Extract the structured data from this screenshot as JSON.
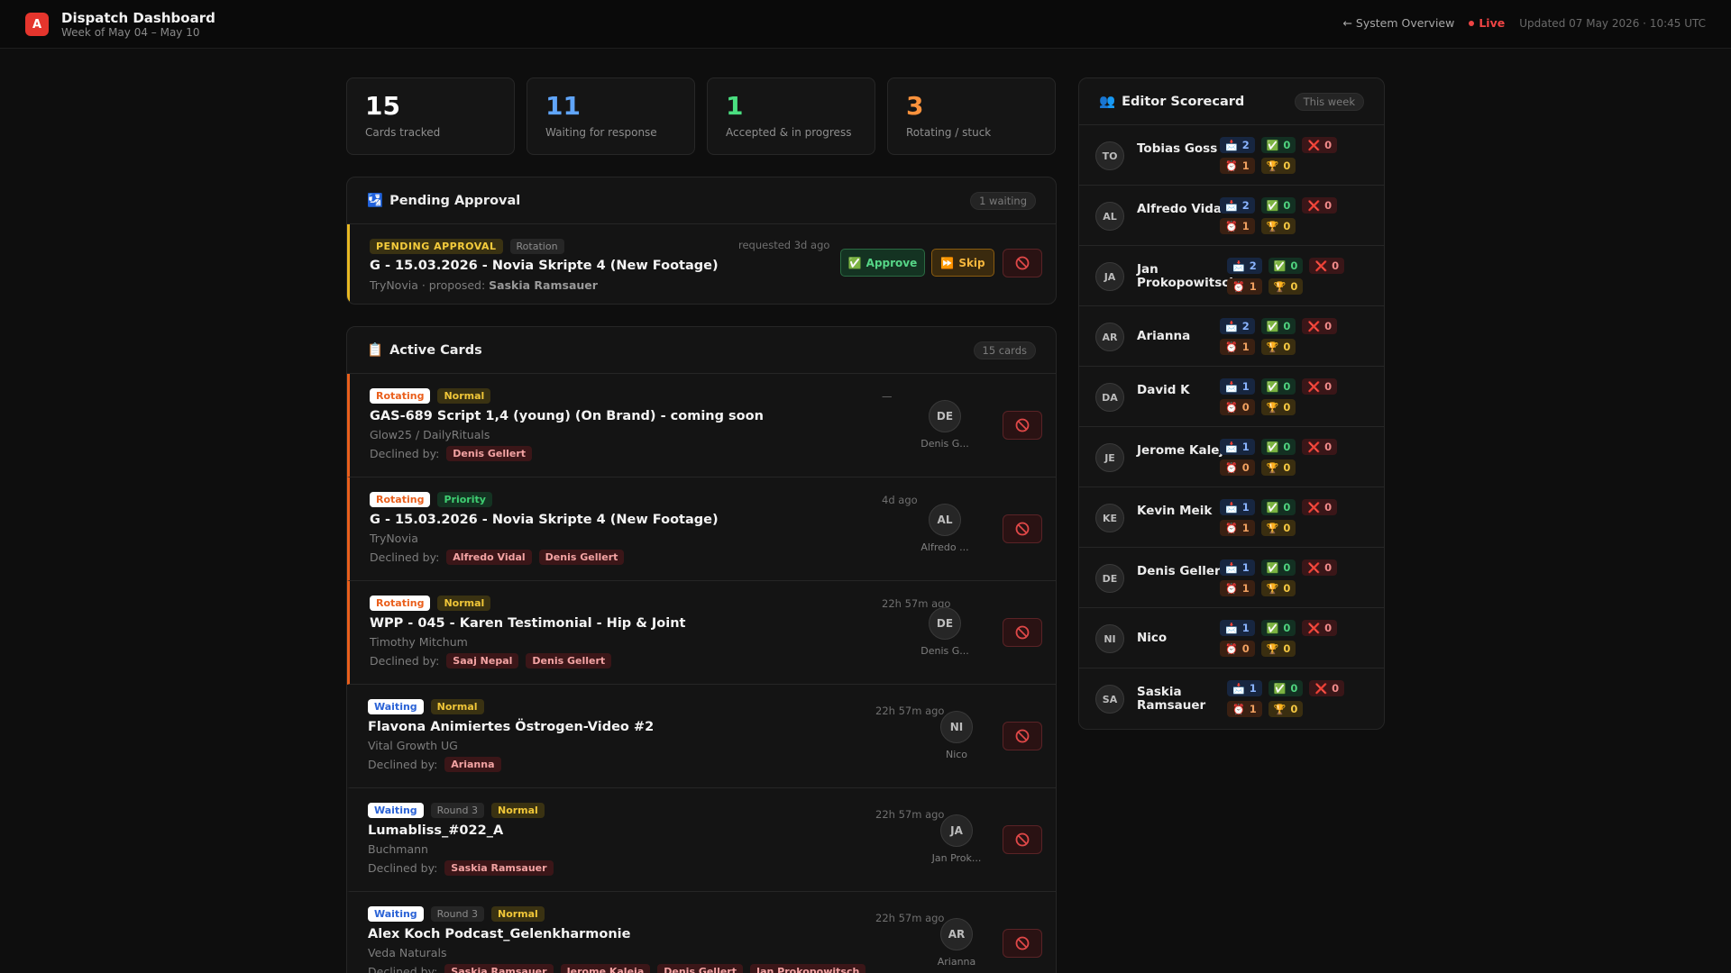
{
  "header": {
    "logo_letter": "A",
    "title": "Dispatch Dashboard",
    "subtitle": "Week of May 04 – May 10",
    "system_link": "← System Overview",
    "live_label": "Live",
    "updated": "Updated 07 May 2026 · 10:45 UTC"
  },
  "stats": [
    {
      "value": "15",
      "label": "Cards tracked",
      "color": "#ffffff"
    },
    {
      "value": "11",
      "label": "Waiting for response",
      "color": "#60a5fa"
    },
    {
      "value": "1",
      "label": "Accepted & in progress",
      "color": "#4ade80"
    },
    {
      "value": "3",
      "label": "Rotating / stuck",
      "color": "#fb923c"
    }
  ],
  "pending": {
    "title": "Pending Approval",
    "count": "1 waiting",
    "item": {
      "status": "PENDING APPROVAL",
      "type": "Rotation",
      "title": "G - 15.03.2026 - Novia Skripte 4 (New Footage)",
      "client": "TryNovia",
      "proposed_prefix": "· proposed:",
      "proposed_by": "Saskia Ramsauer",
      "time": "requested 3d ago",
      "approve_label": "Approve",
      "skip_label": "Skip"
    }
  },
  "active": {
    "title": "Active Cards",
    "count": "15 cards",
    "declined_label": "Declined by:",
    "cards": [
      {
        "kind": "rot",
        "status": "Rotating",
        "round": "",
        "priority": "Normal",
        "title": "GAS-689 Script 1,4 (young) (On Brand) - coming soon",
        "client": "Glow25 / DailyRituals",
        "declined": [
          "Denis Gellert"
        ],
        "time": "—",
        "initials": "DE",
        "assignee": "Denis G..."
      },
      {
        "kind": "rot",
        "status": "Rotating",
        "round": "",
        "priority": "Priority",
        "title": "G - 15.03.2026 - Novia Skripte 4 (New Footage)",
        "client": "TryNovia",
        "declined": [
          "Alfredo Vidal",
          "Denis Gellert"
        ],
        "time": "4d ago",
        "initials": "AL",
        "assignee": "Alfredo ..."
      },
      {
        "kind": "rot",
        "status": "Rotating",
        "round": "",
        "priority": "Normal",
        "title": "WPP - 045 - Karen Testimonial - Hip & Joint",
        "client": "Timothy Mitchum",
        "declined": [
          "Saaj Nepal",
          "Denis Gellert"
        ],
        "time": "22h 57m ago",
        "initials": "DE",
        "assignee": "Denis G..."
      },
      {
        "kind": "wait",
        "status": "Waiting",
        "round": "",
        "priority": "Normal",
        "title": "Flavona Animiertes Östrogen-Video #2",
        "client": "Vital Growth UG",
        "declined": [
          "Arianna"
        ],
        "time": "22h 57m ago",
        "initials": "NI",
        "assignee": "Nico"
      },
      {
        "kind": "wait",
        "status": "Waiting",
        "round": "Round 3",
        "priority": "Normal",
        "title": "Lumabliss_#022_A",
        "client": "Buchmann",
        "declined": [
          "Saskia Ramsauer"
        ],
        "time": "22h 57m ago",
        "initials": "JA",
        "assignee": "Jan Prok..."
      },
      {
        "kind": "wait",
        "status": "Waiting",
        "round": "Round 3",
        "priority": "Normal",
        "title": "Alex Koch Podcast_Gelenkharmonie",
        "client": "Veda Naturals",
        "declined": [
          "Saskia Ramsauer",
          "Jerome Kaleja",
          "Denis Gellert",
          "Jan Prokopowitsch"
        ],
        "time": "22h 57m ago",
        "initials": "AR",
        "assignee": "Arianna"
      }
    ]
  },
  "scorecard": {
    "title": "Editor Scorecard",
    "period": "This week",
    "editors": [
      {
        "initials": "TO",
        "name": "Tobias Goss",
        "sent": "2",
        "ok": "0",
        "no": "0",
        "late": "1",
        "win": "0"
      },
      {
        "initials": "AL",
        "name": "Alfredo Vidal",
        "sent": "2",
        "ok": "0",
        "no": "0",
        "late": "1",
        "win": "0"
      },
      {
        "initials": "JA",
        "name": "Jan Prokopowitsch",
        "sent": "2",
        "ok": "0",
        "no": "0",
        "late": "1",
        "win": "0"
      },
      {
        "initials": "AR",
        "name": "Arianna",
        "sent": "2",
        "ok": "0",
        "no": "0",
        "late": "1",
        "win": "0"
      },
      {
        "initials": "DA",
        "name": "David K",
        "sent": "1",
        "ok": "0",
        "no": "0",
        "late": "0",
        "win": "0"
      },
      {
        "initials": "JE",
        "name": "Jerome Kaleja",
        "sent": "1",
        "ok": "0",
        "no": "0",
        "late": "0",
        "win": "0"
      },
      {
        "initials": "KE",
        "name": "Kevin Meik",
        "sent": "1",
        "ok": "0",
        "no": "0",
        "late": "1",
        "win": "0"
      },
      {
        "initials": "DE",
        "name": "Denis Gellert",
        "sent": "1",
        "ok": "0",
        "no": "0",
        "late": "1",
        "win": "0"
      },
      {
        "initials": "NI",
        "name": "Nico",
        "sent": "1",
        "ok": "0",
        "no": "0",
        "late": "0",
        "win": "0"
      },
      {
        "initials": "SA",
        "name": "Saskia Ramsauer",
        "sent": "1",
        "ok": "0",
        "no": "0",
        "late": "1",
        "win": "0"
      }
    ]
  }
}
